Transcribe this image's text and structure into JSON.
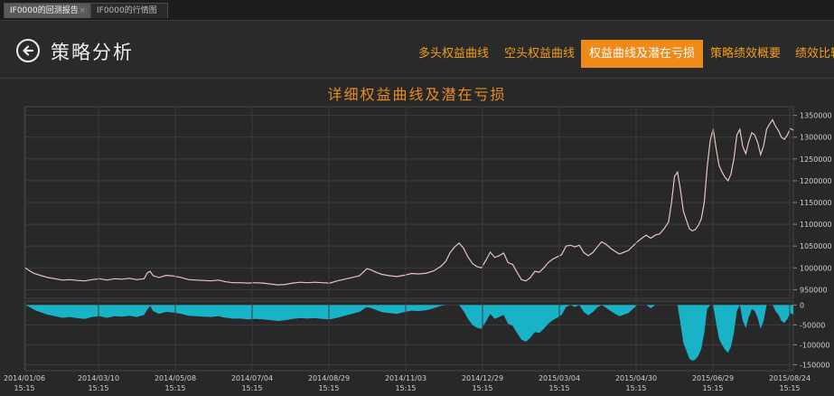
{
  "doc_tabs": [
    {
      "label": "IF0000的回测报告",
      "active": true,
      "close": "×"
    },
    {
      "label": "IF0000的行情图",
      "active": false
    }
  ],
  "header": {
    "back_icon": "arrow-left-circle-icon",
    "title": "策略分析",
    "nav_tabs": [
      {
        "label": "多头权益曲线",
        "active": false
      },
      {
        "label": "空头权益曲线",
        "active": false
      },
      {
        "label": "权益曲线及潜在亏损",
        "active": true
      },
      {
        "label": "策略绩效概要",
        "active": false
      },
      {
        "label": "绩效比较",
        "active": false
      }
    ]
  },
  "colors": {
    "accent": "#ee8a18",
    "equity_line": "#e7c3c0",
    "drawdown_fill": "#19b3c8",
    "background": "#2a2a2a"
  },
  "chart_data": {
    "type": "line",
    "title": "详细权益曲线及潜在亏损",
    "x_ticks": [
      {
        "date": "2014/01/06",
        "time": "15:15"
      },
      {
        "date": "2014/03/10",
        "time": "15:15"
      },
      {
        "date": "2014/05/08",
        "time": "15:15"
      },
      {
        "date": "2014/07/04",
        "time": "15:15"
      },
      {
        "date": "2014/08/29",
        "time": "15:15"
      },
      {
        "date": "2014/11/03",
        "time": "15:15"
      },
      {
        "date": "2014/12/29",
        "time": "15:15"
      },
      {
        "date": "2015/03/04",
        "time": "15:15"
      },
      {
        "date": "2015/04/30",
        "time": "15:15"
      },
      {
        "date": "2015/06/29",
        "time": "15:15"
      },
      {
        "date": "2015/08/24",
        "time": "15:15"
      }
    ],
    "equity": {
      "ylim": [
        930000,
        1370000
      ],
      "y_ticks": [
        950000,
        1000000,
        1050000,
        1100000,
        1150000,
        1200000,
        1250000,
        1300000,
        1350000
      ],
      "y_tick_labels": [
        "950000",
        "1000000",
        "1050000",
        "1100000",
        "1150000",
        "1200000",
        "1250000",
        "1300000",
        "1350000"
      ],
      "values": [
        [
          0,
          1000000
        ],
        [
          3,
          993000
        ],
        [
          6,
          987000
        ],
        [
          10,
          983000
        ],
        [
          15,
          978000
        ],
        [
          20,
          975000
        ],
        [
          25,
          972000
        ],
        [
          30,
          973000
        ],
        [
          35,
          971000
        ],
        [
          40,
          970000
        ],
        [
          45,
          973000
        ],
        [
          50,
          975000
        ],
        [
          55,
          972000
        ],
        [
          60,
          975000
        ],
        [
          65,
          974000
        ],
        [
          70,
          976000
        ],
        [
          75,
          973000
        ],
        [
          80,
          975000
        ],
        [
          82,
          988000
        ],
        [
          84,
          992000
        ],
        [
          86,
          982000
        ],
        [
          90,
          978000
        ],
        [
          95,
          983000
        ],
        [
          100,
          981000
        ],
        [
          105,
          978000
        ],
        [
          110,
          973000
        ],
        [
          115,
          972000
        ],
        [
          120,
          971000
        ],
        [
          125,
          970000
        ],
        [
          130,
          972000
        ],
        [
          135,
          968000
        ],
        [
          140,
          966000
        ],
        [
          145,
          966000
        ],
        [
          150,
          965000
        ],
        [
          155,
          966000
        ],
        [
          160,
          965000
        ],
        [
          165,
          963000
        ],
        [
          170,
          961000
        ],
        [
          175,
          962000
        ],
        [
          180,
          965000
        ],
        [
          185,
          967000
        ],
        [
          190,
          966000
        ],
        [
          195,
          967000
        ],
        [
          200,
          966000
        ],
        [
          205,
          965000
        ],
        [
          210,
          970000
        ],
        [
          215,
          974000
        ],
        [
          220,
          978000
        ],
        [
          225,
          982000
        ],
        [
          230,
          998000
        ],
        [
          233,
          995000
        ],
        [
          236,
          990000
        ],
        [
          240,
          985000
        ],
        [
          245,
          982000
        ],
        [
          250,
          980000
        ],
        [
          255,
          983000
        ],
        [
          260,
          987000
        ],
        [
          265,
          986000
        ],
        [
          270,
          988000
        ],
        [
          275,
          993000
        ],
        [
          280,
          1004000
        ],
        [
          283,
          1015000
        ],
        [
          286,
          1035000
        ],
        [
          289,
          1048000
        ],
        [
          292,
          1057000
        ],
        [
          295,
          1045000
        ],
        [
          298,
          1025000
        ],
        [
          301,
          1010000
        ],
        [
          304,
          1003000
        ],
        [
          307,
          1000000
        ],
        [
          310,
          1017000
        ],
        [
          313,
          1036000
        ],
        [
          316,
          1024000
        ],
        [
          319,
          1028000
        ],
        [
          322,
          1034000
        ],
        [
          325,
          1012000
        ],
        [
          328,
          1008000
        ],
        [
          331,
          990000
        ],
        [
          334,
          973000
        ],
        [
          337,
          970000
        ],
        [
          340,
          978000
        ],
        [
          343,
          992000
        ],
        [
          346,
          990000
        ],
        [
          349,
          1000000
        ],
        [
          352,
          1012000
        ],
        [
          355,
          1020000
        ],
        [
          358,
          1025000
        ],
        [
          361,
          1030000
        ],
        [
          364,
          1050000
        ],
        [
          367,
          1052000
        ],
        [
          370,
          1048000
        ],
        [
          373,
          1052000
        ],
        [
          376,
          1035000
        ],
        [
          379,
          1028000
        ],
        [
          382,
          1035000
        ],
        [
          385,
          1048000
        ],
        [
          388,
          1060000
        ],
        [
          391,
          1054000
        ],
        [
          394,
          1045000
        ],
        [
          397,
          1038000
        ],
        [
          400,
          1032000
        ],
        [
          403,
          1036000
        ],
        [
          406,
          1040000
        ],
        [
          409,
          1050000
        ],
        [
          412,
          1060000
        ],
        [
          415,
          1068000
        ],
        [
          418,
          1075000
        ],
        [
          421,
          1068000
        ],
        [
          424,
          1075000
        ],
        [
          427,
          1078000
        ],
        [
          430,
          1090000
        ],
        [
          433,
          1105000
        ],
        [
          435,
          1150000
        ],
        [
          437,
          1210000
        ],
        [
          439,
          1220000
        ],
        [
          441,
          1180000
        ],
        [
          443,
          1130000
        ],
        [
          445,
          1110000
        ],
        [
          447,
          1090000
        ],
        [
          449,
          1085000
        ],
        [
          451,
          1088000
        ],
        [
          453,
          1097000
        ],
        [
          455,
          1112000
        ],
        [
          457,
          1150000
        ],
        [
          459,
          1230000
        ],
        [
          461,
          1290000
        ],
        [
          463,
          1320000
        ],
        [
          465,
          1275000
        ],
        [
          467,
          1235000
        ],
        [
          469,
          1220000
        ],
        [
          471,
          1208000
        ],
        [
          473,
          1200000
        ],
        [
          475,
          1215000
        ],
        [
          477,
          1250000
        ],
        [
          479,
          1305000
        ],
        [
          481,
          1318000
        ],
        [
          483,
          1278000
        ],
        [
          485,
          1262000
        ],
        [
          487,
          1290000
        ],
        [
          489,
          1310000
        ],
        [
          491,
          1305000
        ],
        [
          493,
          1288000
        ],
        [
          495,
          1260000
        ],
        [
          497,
          1280000
        ],
        [
          499,
          1318000
        ],
        [
          501,
          1330000
        ],
        [
          503,
          1340000
        ],
        [
          505,
          1325000
        ],
        [
          507,
          1315000
        ],
        [
          509,
          1300000
        ],
        [
          511,
          1295000
        ],
        [
          513,
          1305000
        ],
        [
          515,
          1320000
        ],
        [
          517,
          1316000
        ]
      ]
    },
    "drawdown": {
      "ylim": [
        -165000,
        10000
      ],
      "y_ticks": [
        0,
        -50000,
        -100000,
        -150000
      ],
      "y_tick_labels": [
        "0",
        "-50000",
        "-100000",
        "-150000"
      ],
      "values": [
        [
          0,
          0
        ],
        [
          3,
          -5000
        ],
        [
          6,
          -12000
        ],
        [
          10,
          -18000
        ],
        [
          15,
          -24000
        ],
        [
          20,
          -28000
        ],
        [
          25,
          -32000
        ],
        [
          30,
          -30000
        ],
        [
          35,
          -33000
        ],
        [
          40,
          -35000
        ],
        [
          45,
          -30000
        ],
        [
          50,
          -28000
        ],
        [
          55,
          -32000
        ],
        [
          60,
          -28000
        ],
        [
          65,
          -29000
        ],
        [
          70,
          -27000
        ],
        [
          75,
          -30000
        ],
        [
          80,
          -25000
        ],
        [
          82,
          -12000
        ],
        [
          84,
          -2000
        ],
        [
          86,
          -15000
        ],
        [
          90,
          -22000
        ],
        [
          95,
          -17000
        ],
        [
          100,
          -19000
        ],
        [
          105,
          -22000
        ],
        [
          110,
          -27000
        ],
        [
          115,
          -28000
        ],
        [
          120,
          -29000
        ],
        [
          125,
          -30000
        ],
        [
          130,
          -28000
        ],
        [
          135,
          -32000
        ],
        [
          140,
          -34000
        ],
        [
          145,
          -34000
        ],
        [
          150,
          -36000
        ],
        [
          155,
          -35000
        ],
        [
          160,
          -36000
        ],
        [
          165,
          -38000
        ],
        [
          170,
          -40000
        ],
        [
          175,
          -38000
        ],
        [
          180,
          -35000
        ],
        [
          185,
          -33000
        ],
        [
          190,
          -34000
        ],
        [
          195,
          -33000
        ],
        [
          200,
          -35000
        ],
        [
          205,
          -36000
        ],
        [
          210,
          -32000
        ],
        [
          215,
          -27000
        ],
        [
          220,
          -22000
        ],
        [
          225,
          -17000
        ],
        [
          230,
          -5000
        ],
        [
          233,
          -8000
        ],
        [
          236,
          -12000
        ],
        [
          240,
          -18000
        ],
        [
          245,
          -20000
        ],
        [
          250,
          -22000
        ],
        [
          255,
          -18000
        ],
        [
          260,
          -14000
        ],
        [
          265,
          -15000
        ],
        [
          270,
          -13000
        ],
        [
          275,
          -8000
        ],
        [
          280,
          -2000
        ],
        [
          283,
          0
        ],
        [
          286,
          0
        ],
        [
          289,
          0
        ],
        [
          292,
          0
        ],
        [
          295,
          -15000
        ],
        [
          298,
          -35000
        ],
        [
          301,
          -50000
        ],
        [
          304,
          -57000
        ],
        [
          307,
          -60000
        ],
        [
          310,
          -42000
        ],
        [
          313,
          -22000
        ],
        [
          316,
          -35000
        ],
        [
          319,
          -30000
        ],
        [
          322,
          -25000
        ],
        [
          325,
          -47000
        ],
        [
          328,
          -52000
        ],
        [
          331,
          -70000
        ],
        [
          334,
          -87000
        ],
        [
          337,
          -92000
        ],
        [
          340,
          -82000
        ],
        [
          343,
          -68000
        ],
        [
          346,
          -70000
        ],
        [
          349,
          -60000
        ],
        [
          352,
          -47000
        ],
        [
          355,
          -38000
        ],
        [
          358,
          -32000
        ],
        [
          361,
          -25000
        ],
        [
          364,
          -5000
        ],
        [
          367,
          0
        ],
        [
          370,
          -5000
        ],
        [
          373,
          0
        ],
        [
          376,
          -18000
        ],
        [
          379,
          -26000
        ],
        [
          382,
          -18000
        ],
        [
          385,
          -6000
        ],
        [
          388,
          0
        ],
        [
          391,
          -7000
        ],
        [
          394,
          -15000
        ],
        [
          397,
          -22000
        ],
        [
          400,
          -28000
        ],
        [
          403,
          -24000
        ],
        [
          406,
          -20000
        ],
        [
          409,
          -10000
        ],
        [
          412,
          0
        ],
        [
          415,
          0
        ],
        [
          418,
          0
        ],
        [
          421,
          -8000
        ],
        [
          424,
          0
        ],
        [
          427,
          0
        ],
        [
          430,
          0
        ],
        [
          433,
          0
        ],
        [
          435,
          0
        ],
        [
          437,
          0
        ],
        [
          439,
          0
        ],
        [
          441,
          -45000
        ],
        [
          443,
          -95000
        ],
        [
          445,
          -115000
        ],
        [
          447,
          -135000
        ],
        [
          449,
          -140000
        ],
        [
          451,
          -137000
        ],
        [
          453,
          -128000
        ],
        [
          455,
          -110000
        ],
        [
          457,
          -70000
        ],
        [
          459,
          -10000
        ],
        [
          461,
          0
        ],
        [
          463,
          0
        ],
        [
          465,
          -45000
        ],
        [
          467,
          -85000
        ],
        [
          469,
          -100000
        ],
        [
          471,
          -112000
        ],
        [
          473,
          -120000
        ],
        [
          475,
          -105000
        ],
        [
          477,
          -70000
        ],
        [
          479,
          -15000
        ],
        [
          481,
          0
        ],
        [
          483,
          -40000
        ],
        [
          485,
          -58000
        ],
        [
          487,
          -30000
        ],
        [
          489,
          -10000
        ],
        [
          491,
          -15000
        ],
        [
          493,
          -32000
        ],
        [
          495,
          -60000
        ],
        [
          497,
          -40000
        ],
        [
          499,
          0
        ],
        [
          501,
          0
        ],
        [
          503,
          0
        ],
        [
          505,
          -15000
        ],
        [
          507,
          -25000
        ],
        [
          509,
          -40000
        ],
        [
          511,
          -45000
        ],
        [
          513,
          -35000
        ],
        [
          515,
          -20000
        ],
        [
          517,
          -24000
        ]
      ]
    }
  }
}
